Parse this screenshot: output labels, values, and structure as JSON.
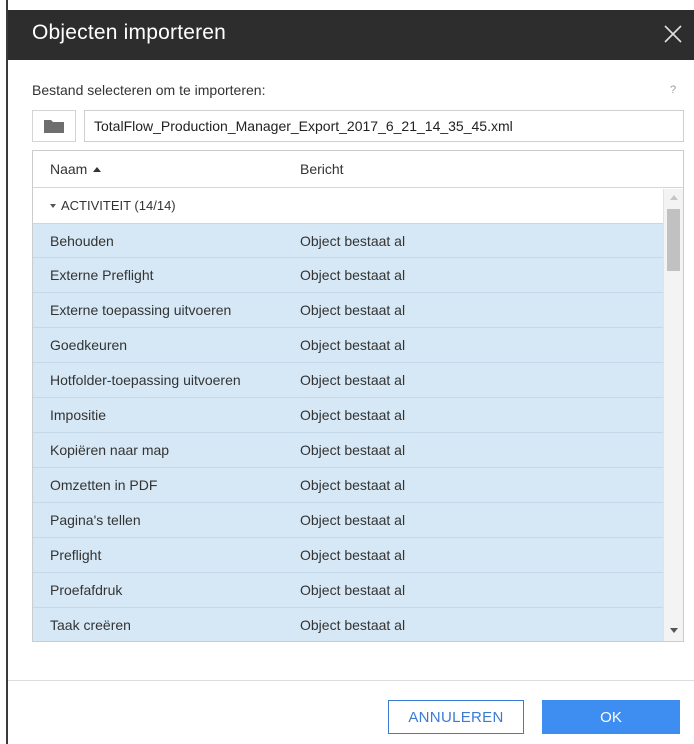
{
  "dialog": {
    "title": "Objecten importeren",
    "close_icon": "close-icon"
  },
  "file": {
    "prompt": "Bestand selecteren om te importeren:",
    "help": "?",
    "folder_icon": "folder-icon",
    "value": "TotalFlow_Production_Manager_Export_2017_6_21_14_35_45.xml"
  },
  "table": {
    "columns": [
      "Naam",
      "Bericht"
    ],
    "sort_icon": "sort-ascending-icon",
    "group": {
      "label": "ACTIVITEIT (14/14)",
      "caret_icon": "caret-down-icon"
    },
    "rows": [
      {
        "name": "Behouden",
        "message": "Object bestaat al"
      },
      {
        "name": "Externe Preflight",
        "message": "Object bestaat al"
      },
      {
        "name": "Externe toepassing uitvoeren",
        "message": "Object bestaat al"
      },
      {
        "name": "Goedkeuren",
        "message": "Object bestaat al"
      },
      {
        "name": "Hotfolder-toepassing uitvoeren",
        "message": "Object bestaat al"
      },
      {
        "name": "Impositie",
        "message": "Object bestaat al"
      },
      {
        "name": "Kopiëren naar map",
        "message": "Object bestaat al"
      },
      {
        "name": "Omzetten in PDF",
        "message": "Object bestaat al"
      },
      {
        "name": "Pagina's tellen",
        "message": "Object bestaat al"
      },
      {
        "name": "Preflight",
        "message": "Object bestaat al"
      },
      {
        "name": "Proefafdruk",
        "message": "Object bestaat al"
      },
      {
        "name": "Taak creëren",
        "message": "Object bestaat al"
      }
    ]
  },
  "buttons": {
    "cancel": "ANNULEREN",
    "ok": "OK"
  },
  "colors": {
    "titlebar": "#2d2d2d",
    "row_selected": "#d6e8f5",
    "primary": "#3d8ef0",
    "secondary_border": "#3b7bd4"
  }
}
